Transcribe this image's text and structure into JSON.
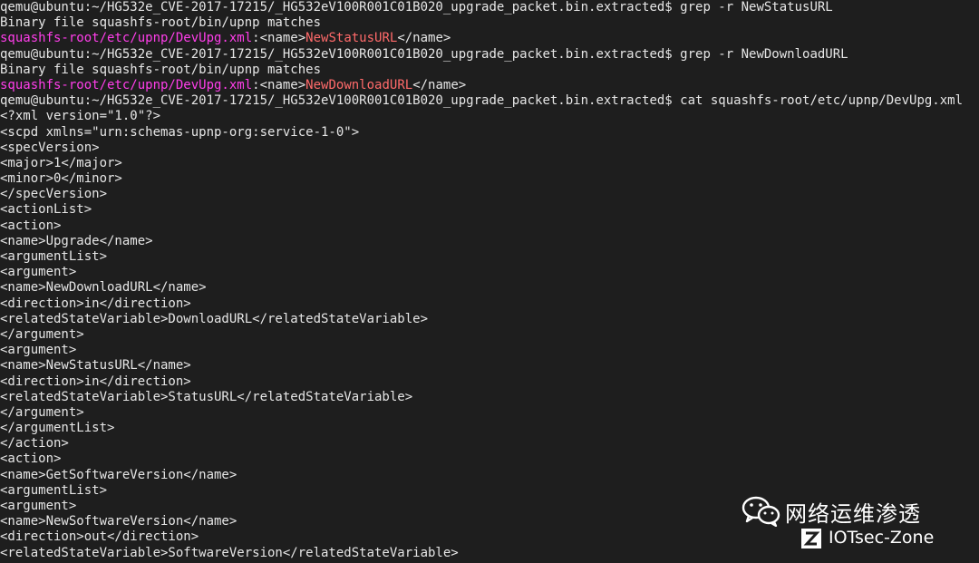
{
  "terminal": {
    "lines": [
      {
        "segments": [
          {
            "text": "qemu@ubuntu:~/HG532e_CVE-2017-17215/_HG532eV100R001C01B020_upgrade_packet.bin.extracted$ grep -r NewStatusURL"
          }
        ]
      },
      {
        "segments": [
          {
            "text": "Binary file squashfs-root/bin/upnp matches"
          }
        ]
      },
      {
        "segments": [
          {
            "text": "squashfs-root/etc/upnp/DevUpg.xml",
            "color": "magenta"
          },
          {
            "text": ":<name>"
          },
          {
            "text": "NewStatusURL",
            "color": "salmon"
          },
          {
            "text": "</name>"
          }
        ]
      },
      {
        "segments": [
          {
            "text": "qemu@ubuntu:~/HG532e_CVE-2017-17215/_HG532eV100R001C01B020_upgrade_packet.bin.extracted$ grep -r NewDownloadURL"
          }
        ]
      },
      {
        "segments": [
          {
            "text": "Binary file squashfs-root/bin/upnp matches"
          }
        ]
      },
      {
        "segments": [
          {
            "text": "squashfs-root/etc/upnp/DevUpg.xml",
            "color": "magenta"
          },
          {
            "text": ":<name>"
          },
          {
            "text": "NewDownloadURL",
            "color": "salmon"
          },
          {
            "text": "</name>"
          }
        ]
      },
      {
        "segments": [
          {
            "text": "qemu@ubuntu:~/HG532e_CVE-2017-17215/_HG532eV100R001C01B020_upgrade_packet.bin.extracted$ cat squashfs-root/etc/upnp/DevUpg.xml"
          }
        ]
      },
      {
        "segments": [
          {
            "text": "<?xml version=\"1.0\"?>"
          }
        ]
      },
      {
        "segments": [
          {
            "text": "<scpd xmlns=\"urn:schemas-upnp-org:service-1-0\">"
          }
        ]
      },
      {
        "segments": [
          {
            "text": "<specVersion>"
          }
        ]
      },
      {
        "segments": [
          {
            "text": "<major>1</major>"
          }
        ]
      },
      {
        "segments": [
          {
            "text": "<minor>0</minor>"
          }
        ]
      },
      {
        "segments": [
          {
            "text": "</specVersion>"
          }
        ]
      },
      {
        "segments": [
          {
            "text": "<actionList>"
          }
        ]
      },
      {
        "segments": [
          {
            "text": "<action>"
          }
        ]
      },
      {
        "segments": [
          {
            "text": "<name>Upgrade</name>"
          }
        ]
      },
      {
        "segments": [
          {
            "text": "<argumentList>"
          }
        ]
      },
      {
        "segments": [
          {
            "text": "<argument>"
          }
        ]
      },
      {
        "segments": [
          {
            "text": "<name>NewDownloadURL</name>"
          }
        ]
      },
      {
        "segments": [
          {
            "text": "<direction>in</direction>"
          }
        ]
      },
      {
        "segments": [
          {
            "text": "<relatedStateVariable>DownloadURL</relatedStateVariable>"
          }
        ]
      },
      {
        "segments": [
          {
            "text": "</argument>"
          }
        ]
      },
      {
        "segments": [
          {
            "text": "<argument>"
          }
        ]
      },
      {
        "segments": [
          {
            "text": "<name>NewStatusURL</name>"
          }
        ]
      },
      {
        "segments": [
          {
            "text": "<direction>in</direction>"
          }
        ]
      },
      {
        "segments": [
          {
            "text": "<relatedStateVariable>StatusURL</relatedStateVariable>"
          }
        ]
      },
      {
        "segments": [
          {
            "text": "</argument>"
          }
        ]
      },
      {
        "segments": [
          {
            "text": "</argumentList>"
          }
        ]
      },
      {
        "segments": [
          {
            "text": "</action>"
          }
        ]
      },
      {
        "segments": [
          {
            "text": "<action>"
          }
        ]
      },
      {
        "segments": [
          {
            "text": "<name>GetSoftwareVersion</name>"
          }
        ]
      },
      {
        "segments": [
          {
            "text": "<argumentList>"
          }
        ]
      },
      {
        "segments": [
          {
            "text": "<argument>"
          }
        ]
      },
      {
        "segments": [
          {
            "text": "<name>NewSoftwareVersion</name>"
          }
        ]
      },
      {
        "segments": [
          {
            "text": "<direction>out</direction>"
          }
        ]
      },
      {
        "segments": [
          {
            "text": "<relatedStateVariable>SoftwareVersion</relatedStateVariable>"
          }
        ]
      }
    ]
  },
  "watermark": {
    "title": "网络运维渗透",
    "subtitle": "IOTsec-Zone",
    "icons": [
      "wechat-icon",
      "z-logo-icon"
    ]
  },
  "colors": {
    "background": "#1e1e1e",
    "text": "#e6e6e6",
    "magenta": "#ff3eea",
    "salmon": "#ff6a6a"
  }
}
